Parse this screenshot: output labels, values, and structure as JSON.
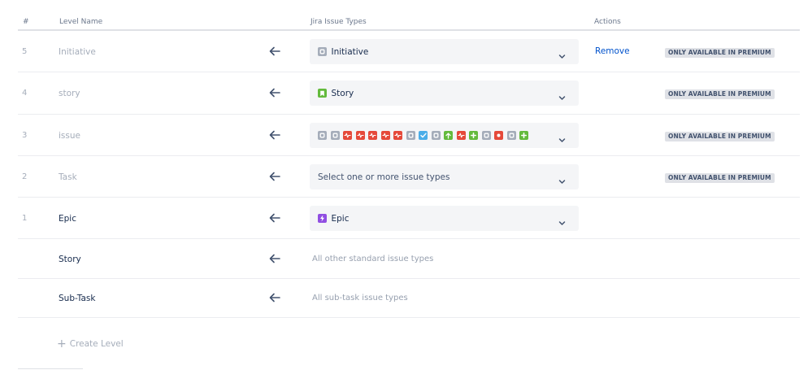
{
  "table": {
    "headers": {
      "num": "#",
      "level_name": "Level Name",
      "issue_types": "Jira Issue Types",
      "actions": "Actions"
    },
    "rows": [
      {
        "num": "5",
        "name": "Initiative",
        "select_label": "Initiative",
        "select_icon": "initiative-icon",
        "action": "Remove",
        "badge": "ONLY AVAILABLE IN PREMIUM"
      },
      {
        "num": "4",
        "name": "story",
        "select_label": "Story",
        "select_icon": "story-icon",
        "badge": "ONLY AVAILABLE IN PREMIUM"
      },
      {
        "num": "3",
        "name": "issue",
        "select_icons": [
          "gray-square-icon",
          "gray-square-icon",
          "red-pulse-icon",
          "red-pulse-icon",
          "red-pulse-icon",
          "red-pulse-icon",
          "red-pulse-icon",
          "gray-square-icon",
          "blue-check-icon",
          "gray-square-icon",
          "green-arrow-up-icon",
          "red-pulse-icon",
          "green-plus-icon",
          "gray-square-icon",
          "red-dot-icon",
          "gray-square-icon",
          "green-plus-icon"
        ],
        "badge": "ONLY AVAILABLE IN PREMIUM"
      },
      {
        "num": "2",
        "name": "Task",
        "select_placeholder": "Select one or more issue types",
        "badge": "ONLY AVAILABLE IN PREMIUM"
      },
      {
        "num": "1",
        "name": "Epic",
        "select_label": "Epic",
        "select_icon": "epic-icon"
      },
      {
        "name": "Story",
        "types_text": "All other standard issue types"
      },
      {
        "name": "Sub-Task",
        "types_text": "All sub-task issue types"
      }
    ]
  },
  "create_level": {
    "plus": "+",
    "label": "Create Level"
  },
  "colors": {
    "gray_icon": "#a5adba",
    "red_icon": "#e5493a",
    "green_icon": "#63ba3c",
    "blue_icon": "#4bade8",
    "purple_icon": "#904ee2",
    "link": "#0052cc"
  }
}
